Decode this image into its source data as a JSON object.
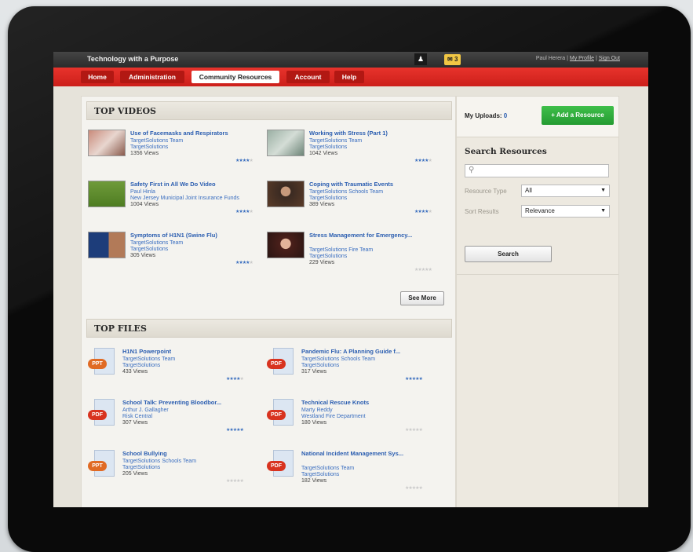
{
  "app_title": "Technology with a Purpose",
  "notification_count": "3",
  "user": {
    "name": "Paul Herera",
    "profile_label": "My Profile",
    "signout_label": "Sign Out"
  },
  "nav": [
    {
      "label": "Home"
    },
    {
      "label": "Administration"
    },
    {
      "label": "Community Resources",
      "active": true
    },
    {
      "label": "Account"
    },
    {
      "label": "Help"
    }
  ],
  "top_videos": {
    "heading": "TOP VIDEOS",
    "see_more_label": "See More",
    "items": [
      {
        "title": "Use of Facemasks and Respirators",
        "author": "TargetSolutions Team",
        "org": "TargetSolutions",
        "views": "1356 Views",
        "rating": 4
      },
      {
        "title": "Working with Stress (Part 1)",
        "author": "TargetSolutions Team",
        "org": "TargetSolutions",
        "views": "1042 Views",
        "rating": 4
      },
      {
        "title": "Safety First in All We Do Video",
        "author": "Paul Hinla",
        "org": "New Jersey Municipal Joint Insurance Funds",
        "views": "1004 Views",
        "rating": 4
      },
      {
        "title": "Coping with Traumatic Events",
        "author": "TargetSolutions Schools Team",
        "org": "TargetSolutions",
        "views": "389 Views",
        "rating": 4
      },
      {
        "title": "Symptoms of H1N1 (Swine Flu)",
        "author": "TargetSolutions Team",
        "org": "TargetSolutions",
        "views": "305 Views",
        "rating": 4
      },
      {
        "title": "Stress Management for Emergency...",
        "author": "TargetSolutions Fire Team",
        "org": "TargetSolutions",
        "views": "229 Views",
        "rating": 0
      }
    ]
  },
  "top_files": {
    "heading": "TOP FILES",
    "items": [
      {
        "title": "H1N1 Powerpoint",
        "author": "TargetSolutions Team",
        "org": "TargetSolutions",
        "views": "433 Views",
        "rating": 4,
        "type": "PPT"
      },
      {
        "title": "Pandemic Flu: A Planning Guide f...",
        "author": "TargetSolutions Schools Team",
        "org": "TargetSolutions",
        "views": "317 Views",
        "rating": 5,
        "type": "PDF"
      },
      {
        "title": "School Talk: Preventing Bloodbor...",
        "author": "Arthur J. Gallagher",
        "org": "Risk Central",
        "views": "307 Views",
        "rating": 5,
        "type": "PDF"
      },
      {
        "title": "Technical Rescue Knots",
        "author": "Marty Reddy",
        "org": "Westland Fire Department",
        "views": "180 Views",
        "rating": 0,
        "type": "PDF"
      },
      {
        "title": "School Bullying",
        "author": "TargetSolutions Schools Team",
        "org": "TargetSolutions",
        "views": "205 Views",
        "rating": 0,
        "type": "PPT"
      },
      {
        "title": "National Incident Management Sys...",
        "author": "TargetSolutions Team",
        "org": "TargetSolutions",
        "views": "182 Views",
        "rating": 0,
        "type": "PDF"
      }
    ]
  },
  "sidebar": {
    "uploads_label": "My Uploads:",
    "uploads_count": "0",
    "add_resource_label": "+ Add a Resource",
    "search_heading": "Search Resources",
    "search_placeholder": "",
    "resource_type_label": "Resource Type",
    "resource_type_value": "All",
    "sort_label": "Sort Results",
    "sort_value": "Relevance",
    "search_button_label": "Search"
  },
  "colors": {
    "accent_red": "#d8261f",
    "link_blue": "#2a5db0",
    "add_green": "#2fae3b"
  }
}
